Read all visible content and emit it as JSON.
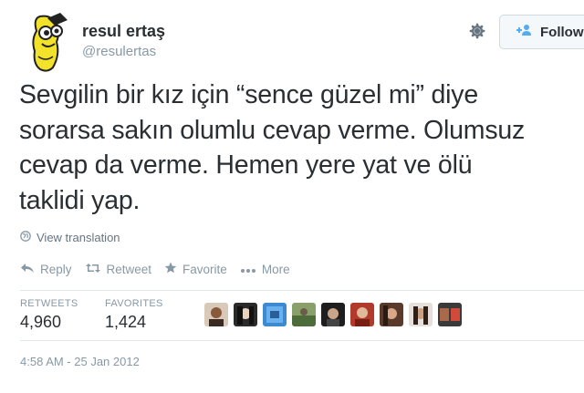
{
  "author": {
    "display_name": "resul ertaş",
    "username": "@resulertas"
  },
  "follow_button": {
    "label": "Follow"
  },
  "tweet": {
    "lines": [
      "Sevgilin bir kız için “sence güzel mi” diye",
      "sorarsa sakın olumlu cevap verme. Olumsuz",
      "cevap da verme. Hemen yere yat ve ölü",
      "taklidi yap."
    ],
    "translation_link": "View translation",
    "timestamp": "4:58 AM - 25 Jan 2012"
  },
  "actions": {
    "reply": "Reply",
    "retweet": "Retweet",
    "favorite": "Favorite",
    "more": "More"
  },
  "stats": {
    "retweets_label": "RETWEETS",
    "retweets_value": "4,960",
    "favorites_label": "FAVORITES",
    "favorites_value": "1,424"
  },
  "colors": {
    "text": "#292f33",
    "muted": "#8899a6",
    "avatar_yellow": "#f2e22a"
  },
  "icons": {
    "settings": "gear-icon",
    "follow": "add-user-icon",
    "translate": "globe-icon",
    "reply": "reply-icon",
    "retweet": "retweet-icon",
    "favorite": "star-icon",
    "more": "more-dots-icon"
  }
}
